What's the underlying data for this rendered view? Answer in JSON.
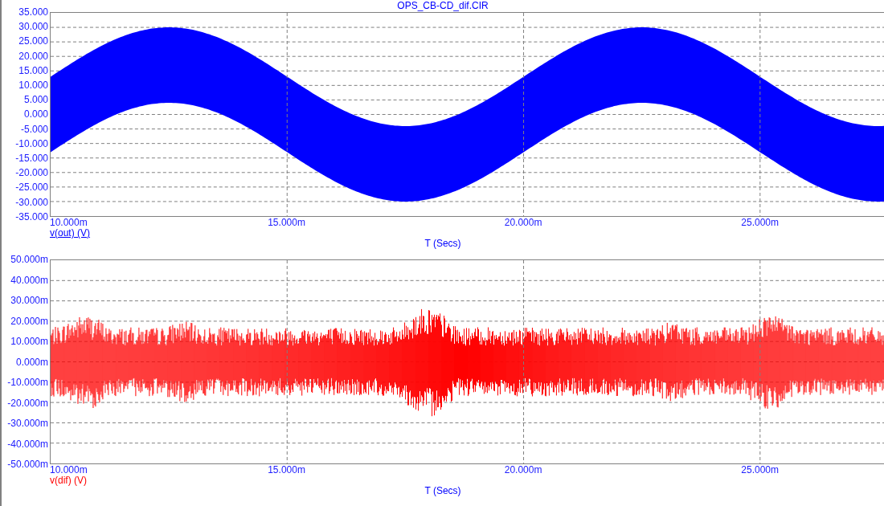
{
  "title": "OPS_CB-CD_dif.CIR",
  "plots": [
    {
      "kind": "band",
      "color": "#0000ff",
      "y_ticks": [
        "35.000",
        "30.000",
        "25.000",
        "20.000",
        "15.000",
        "10.000",
        "5.000",
        "0.000",
        "-5.000",
        "-10.000",
        "-15.000",
        "-20.000",
        "-25.000",
        "-30.000",
        "-35.000"
      ],
      "x_ticks": [
        "10.000m",
        "15.000m",
        "20.000m",
        "25.000m"
      ],
      "trace_label": "v(out) (V)",
      "x_label": "T (Secs)"
    },
    {
      "kind": "noise",
      "color": "#ff0000",
      "y_ticks": [
        "50.000m",
        "40.000m",
        "30.000m",
        "20.000m",
        "10.000m",
        "0.000m",
        "-10.000m",
        "-20.000m",
        "-30.000m",
        "-40.000m",
        "-50.000m"
      ],
      "x_ticks": [
        "10.000m",
        "15.000m",
        "20.000m",
        "25.000m"
      ],
      "trace_label": "v(dif) (V)",
      "x_label": "T (Secs)"
    }
  ]
}
